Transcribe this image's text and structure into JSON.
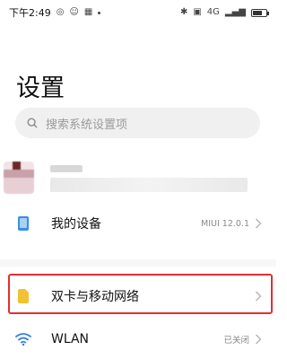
{
  "status_bar": {
    "time": "下午2:49",
    "network": "4G",
    "battery_percent": 70
  },
  "page": {
    "title": "设置"
  },
  "search": {
    "placeholder": "搜索系统设置项"
  },
  "items": {
    "my_device": {
      "label": "我的设备",
      "value": "MIUI 12.0.1"
    },
    "sim": {
      "label": "双卡与移动网络"
    },
    "wlan": {
      "label": "WLAN",
      "value": "已关闭"
    }
  },
  "colors": {
    "highlight": "#e03030",
    "device_icon": "#3a8ee6",
    "sim_icon": "#f1c232",
    "wifi_icon": "#2d7ff0"
  }
}
